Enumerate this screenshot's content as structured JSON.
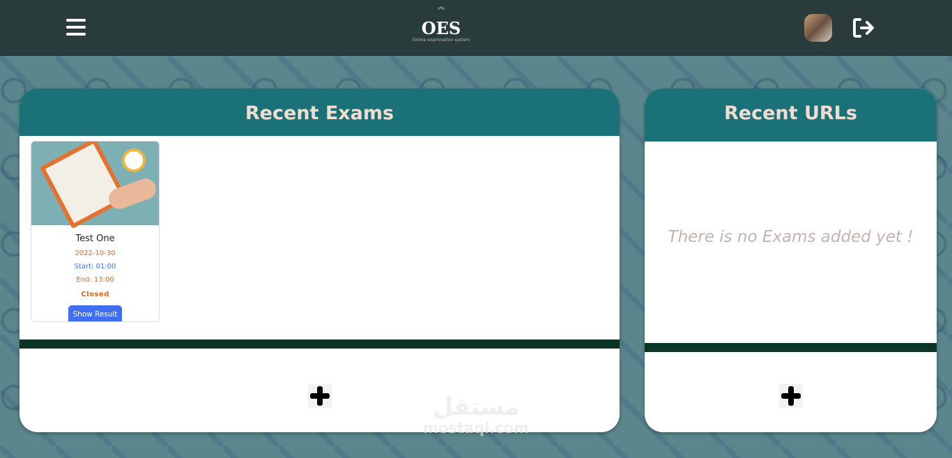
{
  "header": {
    "logo_text": "OES",
    "logo_subtitle": "Online examination system",
    "menu_icon": "hamburger-icon",
    "logout_icon": "logout-icon"
  },
  "recent_exams": {
    "title": "Recent Exams",
    "add_icon": "plus-icon",
    "exams": [
      {
        "title": "Test One",
        "date": "2022-10-30",
        "start": "Start: 01:00",
        "end": "End: 13:00",
        "status": "Closed",
        "action": "Show Result"
      }
    ]
  },
  "recent_urls": {
    "title": "Recent URLs",
    "empty_message": "There is no Exams added yet !",
    "add_icon": "plus-icon"
  },
  "watermark": {
    "arabic": "مستقل",
    "latin": "mostaql.com"
  },
  "colors": {
    "header_bg": "#2a3b3b",
    "panel_head": "#1a7177",
    "divider": "#0d3527",
    "button": "#3f6ff0",
    "status_closed": "#d2691e",
    "date": "#d2691e",
    "start": "#3f6ff0"
  }
}
